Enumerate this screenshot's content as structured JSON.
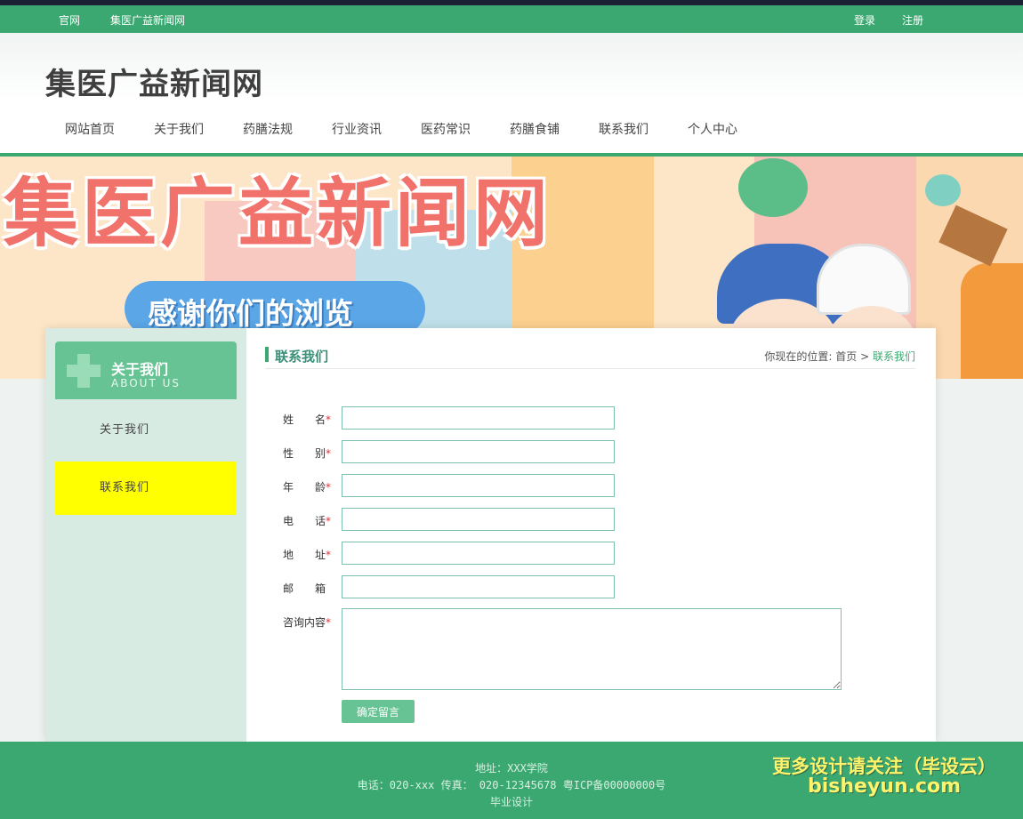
{
  "topbar": {
    "left_links": [
      "官网",
      "集医广益新闻网"
    ],
    "login": "登录",
    "register": "注册"
  },
  "header": {
    "site_title": "集医广益新闻网",
    "nav": [
      "网站首页",
      "关于我们",
      "药膳法规",
      "行业资讯",
      "医药常识",
      "药膳食铺",
      "联系我们",
      "个人中心"
    ]
  },
  "banner": {
    "title": "集医广益新闻网",
    "subtitle": "感谢你们的浏览"
  },
  "sidebar": {
    "title": "关于我们",
    "title_en": "ABOUT US",
    "items": [
      "关于我们",
      "联系我们"
    ],
    "active_index": 1,
    "active_color": "#ffff00"
  },
  "breadcrumb": {
    "title": "联系我们",
    "location_prefix": "你现在的位置:",
    "home": "首页",
    "separator": ">",
    "current": "联系我们"
  },
  "form": {
    "fields": [
      {
        "label": "姓　　名",
        "required": true,
        "value": ""
      },
      {
        "label": "性　　别",
        "required": true,
        "value": ""
      },
      {
        "label": "年　　龄",
        "required": true,
        "value": ""
      },
      {
        "label": "电　　话",
        "required": true,
        "value": ""
      },
      {
        "label": "地　　址",
        "required": true,
        "value": ""
      },
      {
        "label": "邮　　箱",
        "required": false,
        "value": ""
      }
    ],
    "content_label": "咨询内容",
    "content_required": true,
    "submit_label": "确定留言",
    "required_mark": "*"
  },
  "footer": {
    "address": "地址：XXX学院",
    "contact": "电话：020-xxx 传真： 020-12345678 粤ICP备00000000号",
    "note": "毕业设计"
  },
  "watermark": {
    "line1": "更多设计请关注（毕设云）",
    "line2": "bisheyun.com"
  },
  "colors": {
    "brand_green": "#3aa870",
    "accent_green": "#67c394",
    "dark_top": "#1c2236"
  }
}
